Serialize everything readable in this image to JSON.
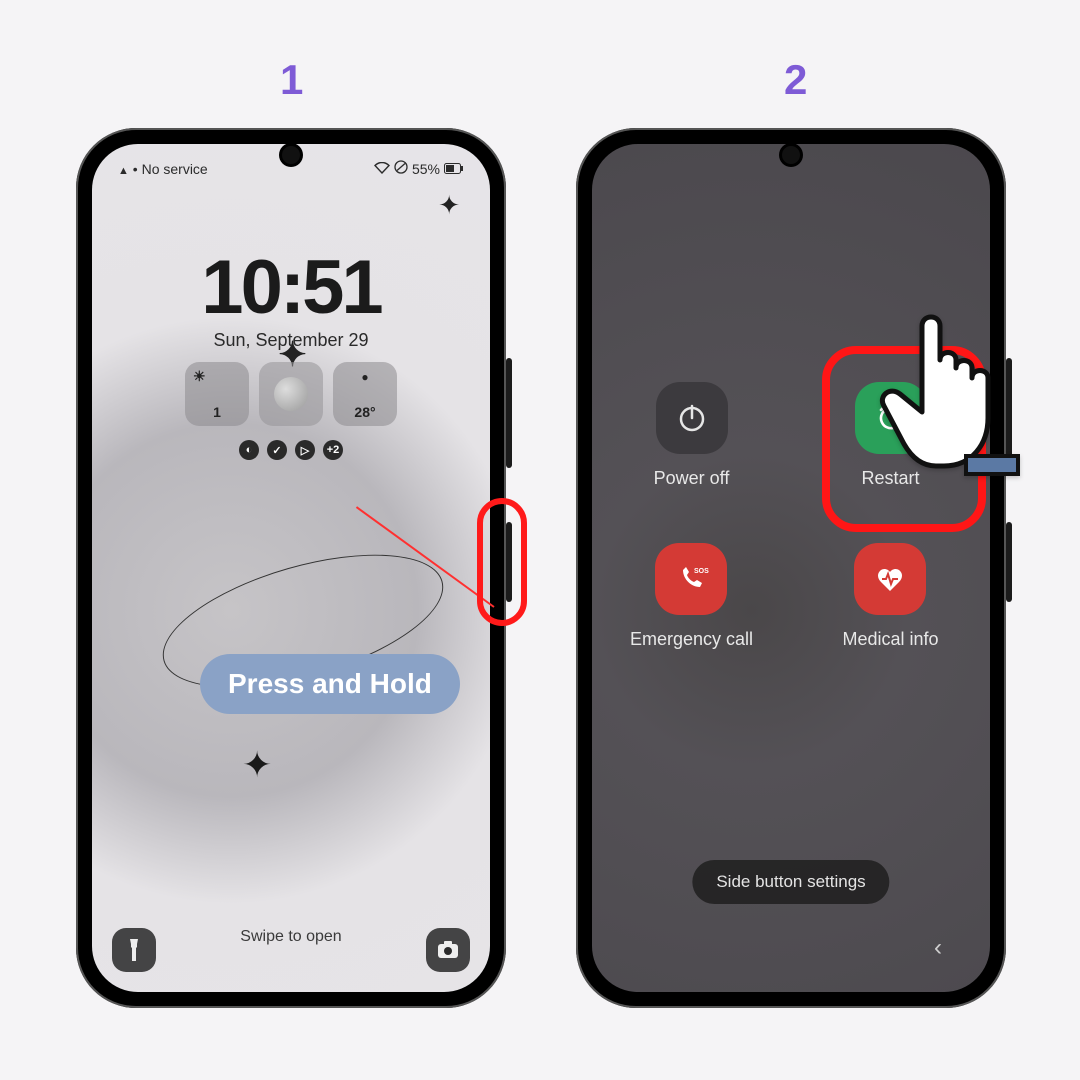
{
  "steps": {
    "one": "1",
    "two": "2"
  },
  "annotation": {
    "press_hold": "Press and Hold"
  },
  "lock": {
    "carrier": "No service",
    "battery": "55%",
    "clock_h": "10",
    "clock_m": "51",
    "date": "Sun, September 29",
    "widget_day": "1",
    "widget_temp": "28°",
    "notif_extra": "+2",
    "swipe": "Swipe to open"
  },
  "power": {
    "power_off": "Power off",
    "restart": "Restart",
    "emergency": "Emergency call",
    "medical": "Medical info",
    "side_settings": "Side button settings"
  }
}
